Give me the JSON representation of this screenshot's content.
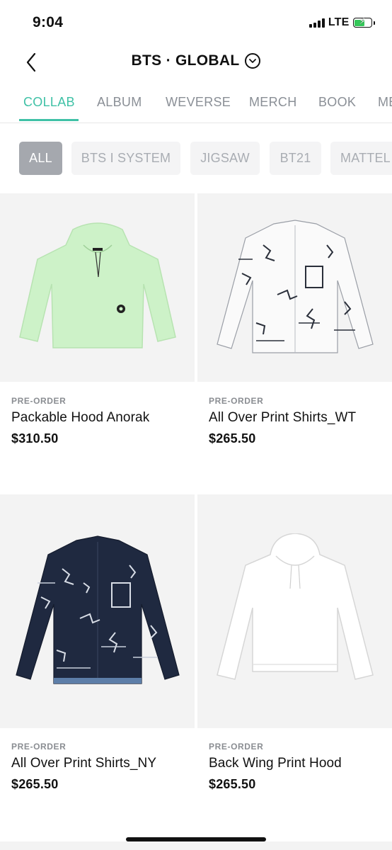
{
  "status_bar": {
    "time": "9:04",
    "network": "LTE",
    "battery_color": "#34c759"
  },
  "header": {
    "back_icon": "chevron-left-icon",
    "title": "BTS · GLOBAL",
    "dropdown_icon": "chevron-down-circle-icon"
  },
  "tabs": [
    {
      "label": "COLLAB",
      "active": true
    },
    {
      "label": "ALBUM",
      "active": false
    },
    {
      "label": "WEVERSE",
      "active": false
    },
    {
      "label": "MERCH",
      "active": false
    },
    {
      "label": "BOOK",
      "active": false
    },
    {
      "label": "ME",
      "active": false
    }
  ],
  "chips": [
    {
      "label": "ALL",
      "active": true
    },
    {
      "label": "BTS I SYSTEM",
      "active": false
    },
    {
      "label": "JIGSAW",
      "active": false
    },
    {
      "label": "BT21",
      "active": false
    },
    {
      "label": "MATTEL",
      "active": false
    }
  ],
  "products": [
    {
      "badge": "PRE-ORDER",
      "name": "Packable Hood Anorak",
      "price": "$310.50",
      "image": "mint-anorak"
    },
    {
      "badge": "PRE-ORDER",
      "name": "All Over Print Shirts_WT",
      "price": "$265.50",
      "image": "white-print-shirt"
    },
    {
      "badge": "PRE-ORDER",
      "name": "All Over Print Shirts_NY",
      "price": "$265.50",
      "image": "navy-print-shirt"
    },
    {
      "badge": "PRE-ORDER",
      "name": "Back Wing Print Hood",
      "price": "$265.50",
      "image": "white-hoodie"
    }
  ],
  "colors": {
    "accent": "#3fc1a6",
    "tab_inactive": "#8a8f96",
    "chip_active_bg": "#a5a8ae",
    "chip_bg": "#f4f4f5"
  }
}
